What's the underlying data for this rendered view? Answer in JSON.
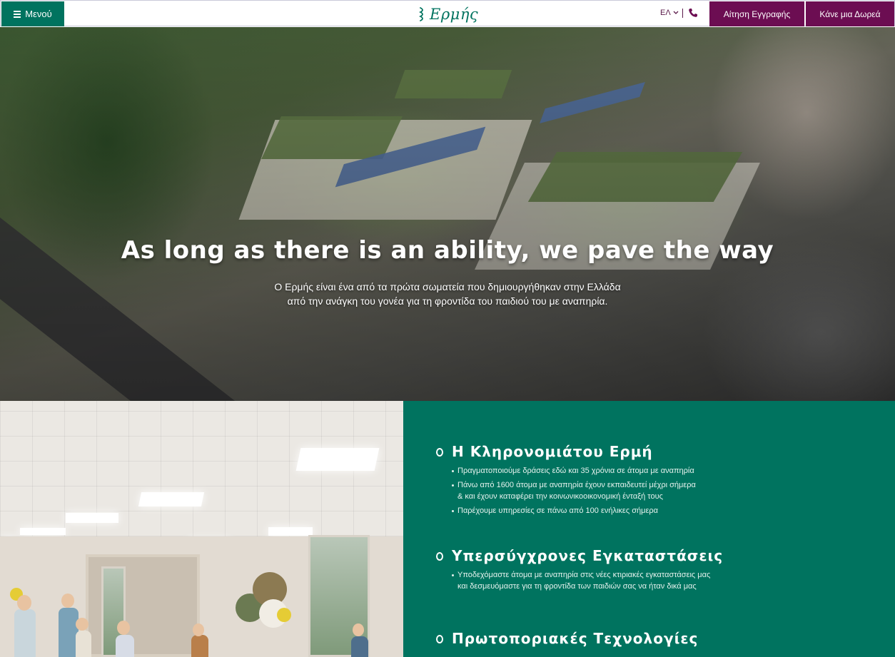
{
  "topbar": {
    "menu_label": "Μενού",
    "logo_text": "Ερμής",
    "lang_label": "ΕΛ",
    "enroll_label": "Αίτηση Εγγραφής",
    "donate_label": "Κάνε μια Δωρεά",
    "accent": "#00735f",
    "cta_color": "#6c0d52"
  },
  "hero": {
    "title": "As long as there is an ability, we pave the way",
    "subtitle_line1": "Ο Ερμής είναι ένα από τα πρώτα σωματεία που δημιουργήθηκαν στην Ελλάδα",
    "subtitle_line2": "από την ανάγκη του γονέα για τη φροντίδα του παιδιού του με αναπηρία."
  },
  "panel": {
    "background": "#00735f",
    "sections": [
      {
        "title": "Η Κληρονομιάτου Ερμή",
        "bullets": [
          [
            "Πραγματοποιούμε δράσεις εδώ και 35 χρόνια σε άτομα με αναπηρία"
          ],
          [
            "Πάνω από 1600 άτομα με αναπηρία έχουν εκπαιδευτεί μέχρι σήμερα",
            "& και έχουν καταφέρει την κοινωνικοοικονομική ένταξή τους"
          ],
          [
            "Παρέχουμε υπηρεσίες σε πάνω από 100 ενήλικες σήμερα"
          ]
        ]
      },
      {
        "title": "Υπερσύγχρονες Εγκαταστάσεις",
        "bullets": [
          [
            "Υποδεχόμαστε άτομα με αναπηρία στις νέες κτιριακές εγκαταστάσεις μας",
            "και δεσμευόμαστε για τη φροντίδα των παιδιών σας να ήταν δικά μας"
          ]
        ]
      },
      {
        "title": "Πρωτοποριακές Τεχνολογίες",
        "bullets": []
      }
    ]
  }
}
